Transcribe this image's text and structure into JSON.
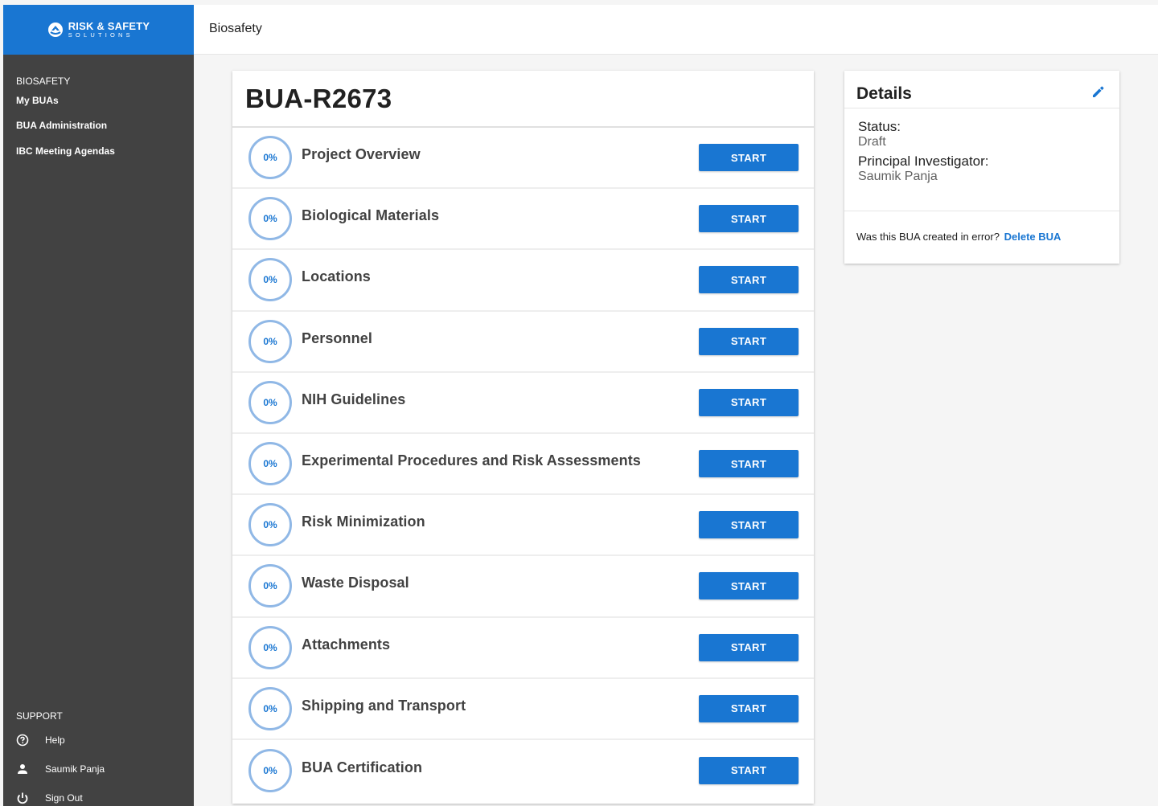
{
  "brand": {
    "logo_line1": "RISK & SAFETY",
    "logo_line2": "SOLUTIONS",
    "color": "#1976d2"
  },
  "sidebar": {
    "section_title": "BIOSAFETY",
    "items": [
      {
        "label": "My BUAs"
      },
      {
        "label": "BUA Administration"
      },
      {
        "label": "IBC Meeting Agendas"
      }
    ],
    "support": {
      "title": "SUPPORT",
      "items": [
        {
          "label": "Help",
          "icon": "help-circle-icon"
        },
        {
          "label": "Saumik Panja",
          "icon": "user-icon"
        },
        {
          "label": "Sign Out",
          "icon": "power-icon"
        }
      ]
    }
  },
  "topbar": {
    "title": "Biosafety"
  },
  "main": {
    "title": "BUA-R2673",
    "sections": [
      {
        "name": "Project Overview",
        "progress": "0%",
        "button": "START"
      },
      {
        "name": "Biological Materials",
        "progress": "0%",
        "button": "START"
      },
      {
        "name": "Locations",
        "progress": "0%",
        "button": "START"
      },
      {
        "name": "Personnel",
        "progress": "0%",
        "button": "START"
      },
      {
        "name": "NIH Guidelines",
        "progress": "0%",
        "button": "START"
      },
      {
        "name": "Experimental Procedures and Risk Assessments",
        "progress": "0%",
        "button": "START"
      },
      {
        "name": "Risk Minimization",
        "progress": "0%",
        "button": "START"
      },
      {
        "name": "Waste Disposal",
        "progress": "0%",
        "button": "START"
      },
      {
        "name": "Attachments",
        "progress": "0%",
        "button": "START"
      },
      {
        "name": "Shipping and Transport",
        "progress": "0%",
        "button": "START"
      },
      {
        "name": "BUA Certification",
        "progress": "0%",
        "button": "START"
      }
    ]
  },
  "details": {
    "title": "Details",
    "status_label": "Status:",
    "status_value": "Draft",
    "pi_label": "Principal Investigator:",
    "pi_value": "Saumik Panja",
    "error_prompt": "Was this BUA created in error?",
    "delete_label": "Delete BUA"
  }
}
